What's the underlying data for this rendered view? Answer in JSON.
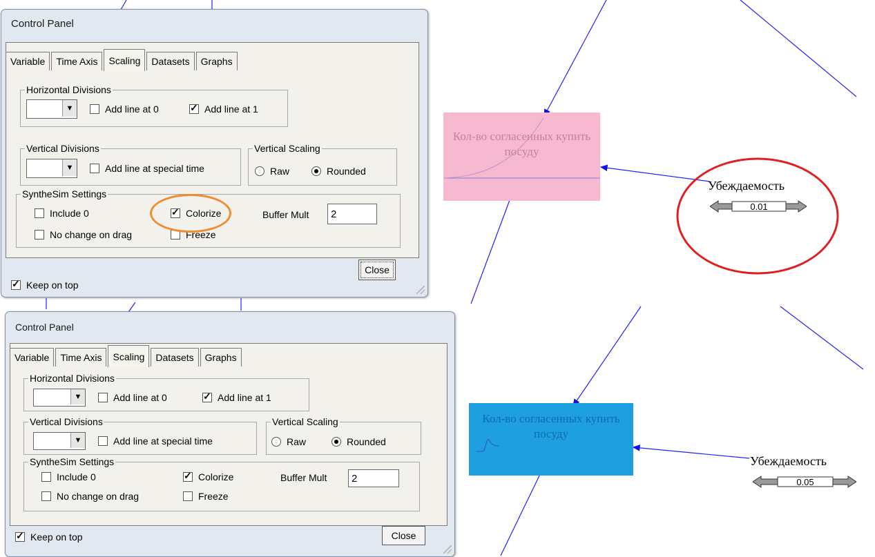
{
  "top_panel": {
    "title": "Control Panel",
    "tabs": [
      "Variable",
      "Time Axis",
      "Scaling",
      "Datasets",
      "Graphs"
    ],
    "active_tab": "Scaling",
    "horizontal_divisions": {
      "label": "Horizontal Divisions",
      "add_line_0": "Add line at 0",
      "add_line_0_checked": false,
      "add_line_1": "Add line at 1",
      "add_line_1_checked": true
    },
    "vertical_divisions": {
      "label": "Vertical Divisions",
      "add_line_special": "Add line at special time",
      "add_line_special_checked": false
    },
    "vertical_scaling": {
      "label": "Vertical Scaling",
      "raw": "Raw",
      "rounded": "Rounded",
      "selected": "Rounded"
    },
    "synthesim": {
      "label": "SyntheSim Settings",
      "include_0": "Include 0",
      "include_0_checked": false,
      "colorize": "Colorize",
      "colorize_checked": true,
      "no_change_on_drag": "No change on drag",
      "no_change_on_drag_checked": false,
      "freeze": "Freeze",
      "freeze_checked": false,
      "buffer_mult_label": "Buffer Mult",
      "buffer_mult_value": "2"
    },
    "keep_on_top": "Keep on top",
    "keep_on_top_checked": true,
    "close_label": "Close"
  },
  "bottom_panel": {
    "title": "Control Panel",
    "tabs": [
      "Variable",
      "Time Axis",
      "Scaling",
      "Datasets",
      "Graphs"
    ],
    "active_tab": "Scaling",
    "horizontal_divisions": {
      "label": "Horizontal Divisions",
      "add_line_0": "Add line at 0",
      "add_line_0_checked": false,
      "add_line_1": "Add line at 1",
      "add_line_1_checked": true
    },
    "vertical_divisions": {
      "label": "Vertical Divisions",
      "add_line_special": "Add line at special time",
      "add_line_special_checked": false
    },
    "vertical_scaling": {
      "label": "Vertical Scaling",
      "raw": "Raw",
      "rounded": "Rounded",
      "selected": "Rounded"
    },
    "synthesim": {
      "label": "SyntheSim Settings",
      "include_0": "Include 0",
      "include_0_checked": false,
      "colorize": "Colorize",
      "colorize_checked": true,
      "no_change_on_drag": "No change on drag",
      "no_change_on_drag_checked": false,
      "freeze": "Freeze",
      "freeze_checked": false,
      "buffer_mult_label": "Buffer Mult",
      "buffer_mult_value": "2"
    },
    "keep_on_top": "Keep on top",
    "keep_on_top_checked": true,
    "close_label": "Close"
  },
  "diagram_top": {
    "stock_label": "Кол-во согласенных купить посуду",
    "stock_color": "#f7b9cf",
    "variable_label": "Убеждаемость",
    "slider_value": "0.01",
    "highlight_ellipse_color": "#e02020",
    "highlight_colorize_color": "#f08c30"
  },
  "diagram_bottom": {
    "stock_label": "Кол-во согласенных купить посуду",
    "stock_color": "#1ea0e0",
    "variable_label": "Убеждаемость",
    "slider_value": "0.05"
  },
  "colors": {
    "link_line": "#2020ff",
    "window_frame": "#e2e8f0",
    "panel_bg": "#f2f1ec"
  }
}
